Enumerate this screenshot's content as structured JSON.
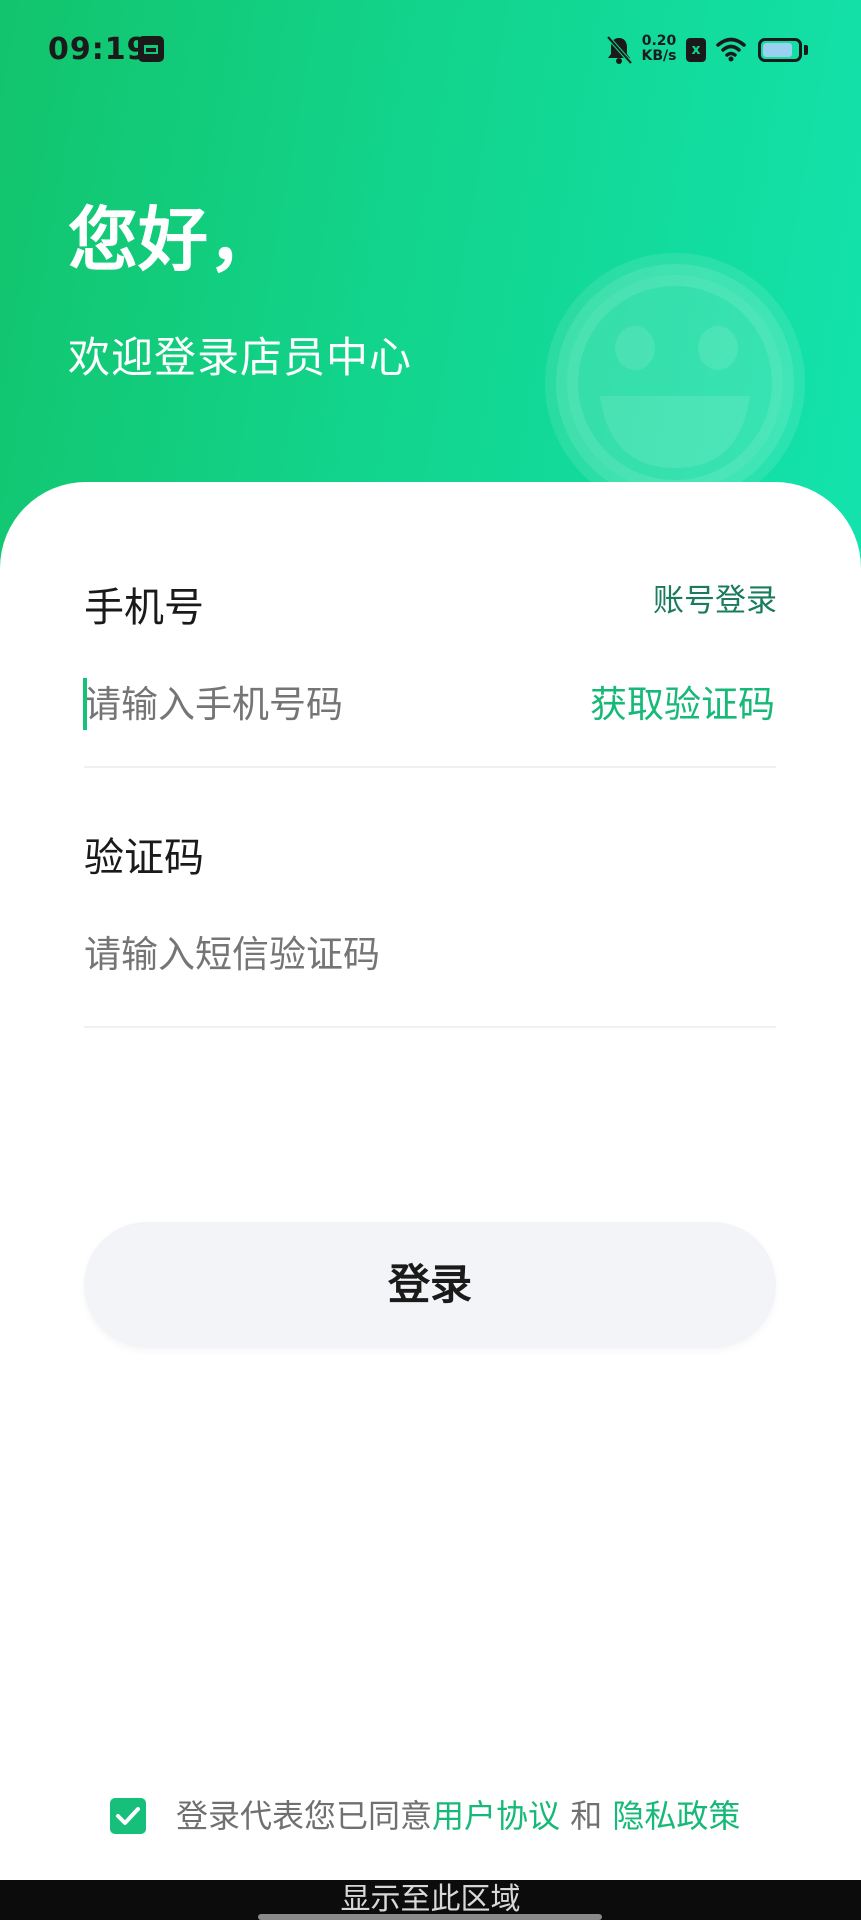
{
  "status_bar": {
    "time": "09:19",
    "net_speed_value": "0.20",
    "net_speed_unit": "KB/s",
    "sim_label": "x",
    "battery_level": 0.85,
    "icons": [
      "app-icon",
      "bell-off-icon",
      "sim-icon",
      "wifi-icon",
      "battery-icon"
    ]
  },
  "header": {
    "greeting": "您好，",
    "welcome": "欢迎登录店员中心",
    "background_gradient": [
      "#12c46c",
      "#13e3ae"
    ],
    "decoration_icon": "smiley-icon"
  },
  "form": {
    "phone_label": "手机号",
    "account_login_label": "账号登录",
    "phone_placeholder": "请输入手机号码",
    "get_code_label": "获取验证码",
    "code_label": "验证码",
    "code_placeholder": "请输入短信验证码",
    "login_button_label": "登录"
  },
  "agreement": {
    "checked": true,
    "prefix": "登录代表您已同意",
    "user_agreement": "用户协议",
    "conjunction": " 和 ",
    "privacy_policy": "隐私政策"
  },
  "bottom_bar": {
    "label": "显示至此区域"
  },
  "colors": {
    "accent": "#16b978",
    "account_link": "#1b7b5f",
    "button_bg": "#f3f4f7",
    "text_primary": "#1a1a1a",
    "text_placeholder": "#8a8a8a"
  }
}
